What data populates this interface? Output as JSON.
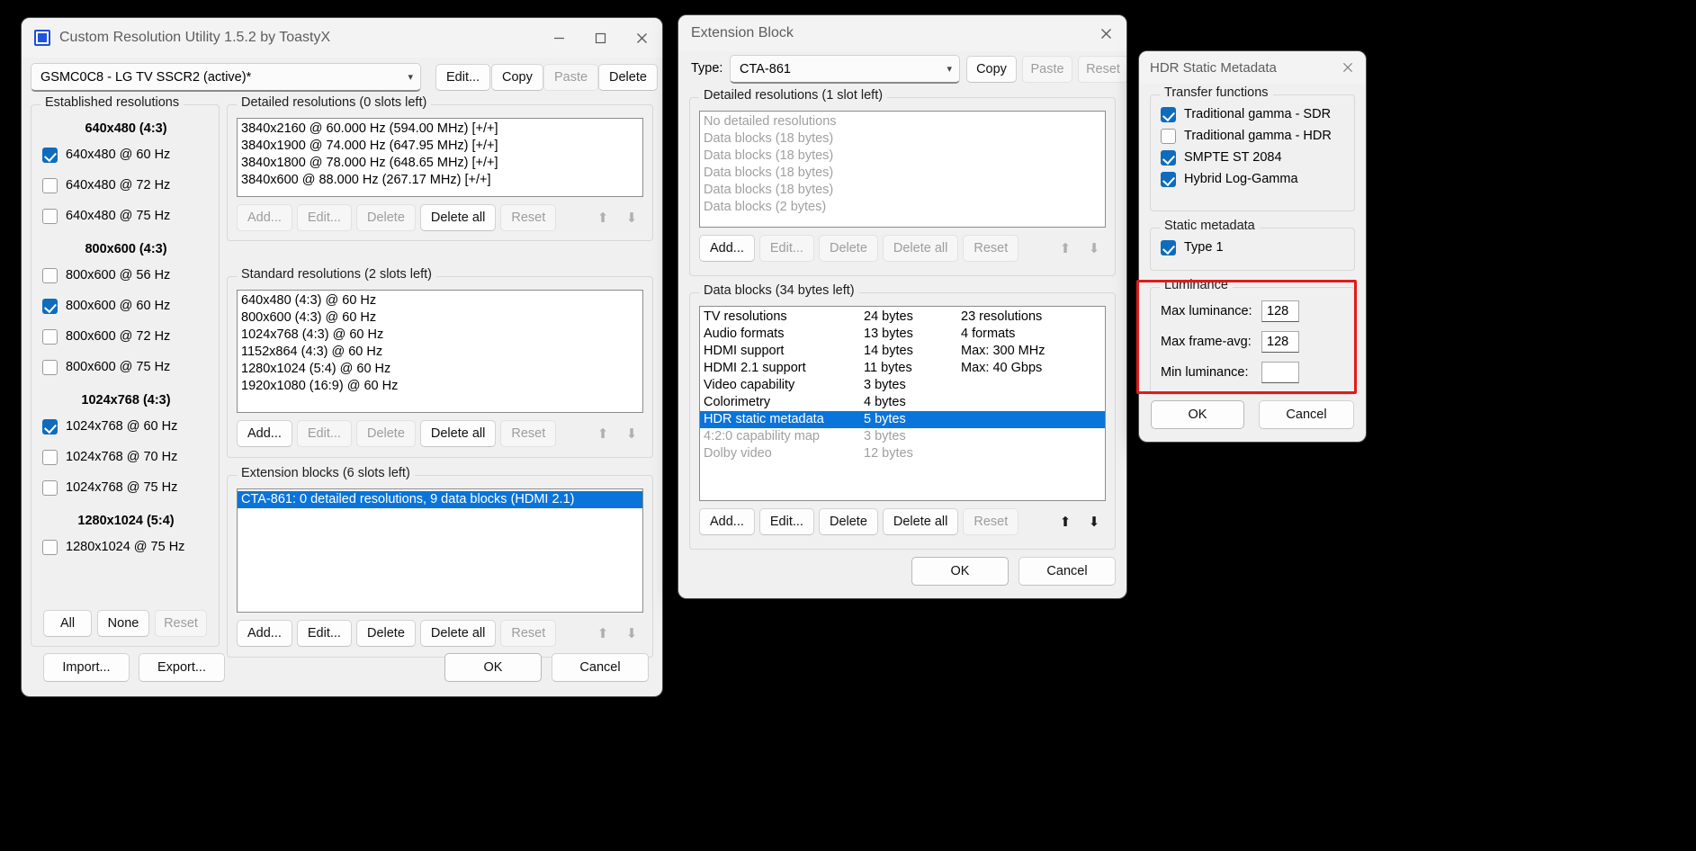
{
  "main_window": {
    "title": "Custom Resolution Utility 1.5.2 by ToastyX",
    "icon": "monitor-icon",
    "caption": {
      "minimize": "minimize-icon",
      "maximize": "maximize-icon",
      "close": "close-icon"
    },
    "monitor_combo": {
      "value": "GSMC0C8 - LG TV SSCR2 (active)*"
    },
    "top_buttons": [
      {
        "label": "Edit...",
        "enabled": true
      },
      {
        "label": "Copy",
        "enabled": true
      },
      {
        "label": "Paste",
        "enabled": false
      },
      {
        "label": "Delete",
        "enabled": true
      }
    ],
    "established": {
      "title": "Established resolutions",
      "groups": [
        {
          "heading": "640x480 (4:3)",
          "items": [
            {
              "label": "640x480 @ 60 Hz",
              "checked": true
            },
            {
              "label": "640x480 @ 72 Hz",
              "checked": false
            },
            {
              "label": "640x480 @ 75 Hz",
              "checked": false
            }
          ]
        },
        {
          "heading": "800x600 (4:3)",
          "items": [
            {
              "label": "800x600 @ 56 Hz",
              "checked": false
            },
            {
              "label": "800x600 @ 60 Hz",
              "checked": true
            },
            {
              "label": "800x600 @ 72 Hz",
              "checked": false
            },
            {
              "label": "800x600 @ 75 Hz",
              "checked": false
            }
          ]
        },
        {
          "heading": "1024x768 (4:3)",
          "items": [
            {
              "label": "1024x768 @ 60 Hz",
              "checked": true
            },
            {
              "label": "1024x768 @ 70 Hz",
              "checked": false
            },
            {
              "label": "1024x768 @ 75 Hz",
              "checked": false
            }
          ]
        },
        {
          "heading": "1280x1024 (5:4)",
          "items": [
            {
              "label": "1280x1024 @ 75 Hz",
              "checked": false
            }
          ]
        }
      ],
      "buttons": [
        {
          "label": "All",
          "enabled": true
        },
        {
          "label": "None",
          "enabled": true
        },
        {
          "label": "Reset",
          "enabled": false
        }
      ]
    },
    "detailed": {
      "title": "Detailed resolutions (0 slots left)",
      "rows": [
        "3840x2160 @ 60.000 Hz (594.00 MHz) [+/+]",
        "3840x1900 @ 74.000 Hz (647.95 MHz) [+/+]",
        "3840x1800 @ 78.000 Hz (648.65 MHz) [+/+]",
        "3840x600 @ 88.000 Hz (267.17 MHz) [+/+]"
      ],
      "buttons": [
        {
          "label": "Add...",
          "enabled": false
        },
        {
          "label": "Edit...",
          "enabled": false
        },
        {
          "label": "Delete",
          "enabled": false
        },
        {
          "label": "Delete all",
          "enabled": true
        },
        {
          "label": "Reset",
          "enabled": false
        }
      ],
      "up_arrow": "arrow-up-icon",
      "down_arrow": "arrow-down-icon"
    },
    "standard": {
      "title": "Standard resolutions (2 slots left)",
      "rows": [
        "640x480 (4:3) @ 60 Hz",
        "800x600 (4:3) @ 60 Hz",
        "1024x768 (4:3) @ 60 Hz",
        "1152x864 (4:3) @ 60 Hz",
        "1280x1024 (5:4) @ 60 Hz",
        "1920x1080 (16:9) @ 60 Hz"
      ],
      "buttons": [
        {
          "label": "Add...",
          "enabled": true
        },
        {
          "label": "Edit...",
          "enabled": false
        },
        {
          "label": "Delete",
          "enabled": false
        },
        {
          "label": "Delete all",
          "enabled": true
        },
        {
          "label": "Reset",
          "enabled": false
        }
      ],
      "up_arrow": "arrow-up-icon",
      "down_arrow": "arrow-down-icon"
    },
    "extension": {
      "title": "Extension blocks (6 slots left)",
      "rows": [
        {
          "label": "CTA-861: 0 detailed resolutions, 9 data blocks (HDMI 2.1)",
          "selected": true
        }
      ],
      "buttons": [
        {
          "label": "Add...",
          "enabled": true
        },
        {
          "label": "Edit...",
          "enabled": true
        },
        {
          "label": "Delete",
          "enabled": true
        },
        {
          "label": "Delete all",
          "enabled": true
        },
        {
          "label": "Reset",
          "enabled": false
        }
      ],
      "up_arrow": "arrow-up-icon",
      "down_arrow": "arrow-down-icon"
    },
    "footer": {
      "import": "Import...",
      "export": "Export...",
      "ok": "OK",
      "cancel": "Cancel"
    }
  },
  "extension_window": {
    "title": "Extension Block",
    "close": "close-icon",
    "type_label": "Type:",
    "type_value": "CTA-861",
    "header_buttons": [
      {
        "label": "Copy",
        "enabled": true
      },
      {
        "label": "Paste",
        "enabled": false
      },
      {
        "label": "Reset",
        "enabled": false
      }
    ],
    "detailed": {
      "title": "Detailed resolutions (1 slot left)",
      "rows": [
        "No detailed resolutions",
        "Data blocks (18 bytes)",
        "Data blocks (18 bytes)",
        "Data blocks (18 bytes)",
        "Data blocks (18 bytes)",
        "Data blocks (2 bytes)"
      ],
      "buttons": [
        {
          "label": "Add...",
          "enabled": true
        },
        {
          "label": "Edit...",
          "enabled": false
        },
        {
          "label": "Delete",
          "enabled": false
        },
        {
          "label": "Delete all",
          "enabled": false
        },
        {
          "label": "Reset",
          "enabled": false
        }
      ],
      "up_arrow": "arrow-up-icon",
      "down_arrow": "arrow-down-icon"
    },
    "data_blocks": {
      "title": "Data blocks (34 bytes left)",
      "rows": [
        {
          "name": "TV resolutions",
          "size": "24 bytes",
          "info": "23 resolutions",
          "selected": false,
          "dim": false
        },
        {
          "name": "Audio formats",
          "size": "13 bytes",
          "info": "4 formats",
          "selected": false,
          "dim": false
        },
        {
          "name": "HDMI support",
          "size": "14 bytes",
          "info": "Max: 300 MHz",
          "selected": false,
          "dim": false
        },
        {
          "name": "HDMI 2.1 support",
          "size": "11 bytes",
          "info": "Max: 40 Gbps",
          "selected": false,
          "dim": false
        },
        {
          "name": "Video capability",
          "size": "3 bytes",
          "info": "",
          "selected": false,
          "dim": false
        },
        {
          "name": "Colorimetry",
          "size": "4 bytes",
          "info": "",
          "selected": false,
          "dim": false
        },
        {
          "name": "HDR static metadata",
          "size": "5 bytes",
          "info": "",
          "selected": true,
          "dim": false
        },
        {
          "name": "4:2:0 capability map",
          "size": "3 bytes",
          "info": "",
          "selected": false,
          "dim": true
        },
        {
          "name": "Dolby video",
          "size": "12 bytes",
          "info": "",
          "selected": false,
          "dim": true
        }
      ],
      "buttons": [
        {
          "label": "Add...",
          "enabled": true
        },
        {
          "label": "Edit...",
          "enabled": true
        },
        {
          "label": "Delete",
          "enabled": true
        },
        {
          "label": "Delete all",
          "enabled": true
        },
        {
          "label": "Reset",
          "enabled": false
        }
      ],
      "up_arrow": "arrow-up-icon",
      "down_arrow": "arrow-down-icon"
    },
    "footer": {
      "ok": "OK",
      "cancel": "Cancel"
    }
  },
  "hdr_window": {
    "title": "HDR Static Metadata",
    "close": "close-icon",
    "transfer": {
      "title": "Transfer functions",
      "items": [
        {
          "label": "Traditional gamma - SDR",
          "checked": true
        },
        {
          "label": "Traditional gamma - HDR",
          "checked": false
        },
        {
          "label": "SMPTE ST 2084",
          "checked": true
        },
        {
          "label": "Hybrid Log-Gamma",
          "checked": true
        }
      ]
    },
    "static_metadata": {
      "title": "Static metadata",
      "items": [
        {
          "label": "Type 1",
          "checked": true
        }
      ]
    },
    "luminance": {
      "title": "Luminance",
      "highlight_color": "#e01b1b",
      "fields": [
        {
          "label": "Max luminance:",
          "value": "128"
        },
        {
          "label": "Max frame-avg:",
          "value": "128"
        },
        {
          "label": "Min luminance:",
          "value": ""
        }
      ]
    },
    "footer": {
      "ok": "OK",
      "cancel": "Cancel"
    }
  }
}
